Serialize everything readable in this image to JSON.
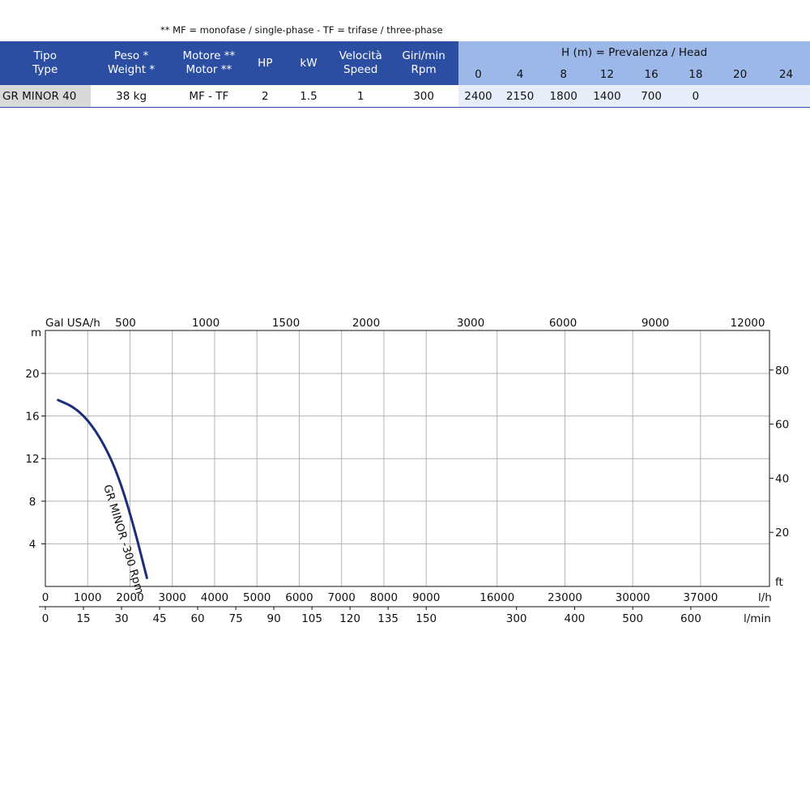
{
  "note": "** MF =  monofase / single-phase - TF =  trifase / three-phase",
  "table": {
    "headers": {
      "tipo": "Tipo",
      "type": "Type",
      "peso": "Peso  *",
      "weight": "Weight *",
      "motore": "Motore **",
      "motor": "Motor **",
      "hp": "HP",
      "kw": "kW",
      "velocita": "Velocità",
      "speed": "Speed",
      "giri": "Giri/min",
      "rpm": "Rpm",
      "head_title": "H (m)  =  Prevalenza  /  Head",
      "heads": [
        "0",
        "4",
        "8",
        "12",
        "16",
        "18",
        "20",
        "24"
      ]
    },
    "row": {
      "type": "GR  MINOR 40",
      "weight": "38 kg",
      "motor": "MF - TF",
      "hp": "2",
      "kw": "1.5",
      "speed": "1",
      "rpm": "300",
      "flows": [
        "2400",
        "2150",
        "1800",
        "1400",
        "700",
        "0",
        "",
        ""
      ]
    }
  },
  "chart_data": {
    "type": "line",
    "series": [
      {
        "name": "GR MINOR -300 Rpm",
        "x_lh": [
          300,
          700,
          1100,
          1500,
          1800,
          2100,
          2400
        ],
        "y_m": [
          17.5,
          16.8,
          15.2,
          12.5,
          9.5,
          5.5,
          0.8
        ]
      }
    ],
    "left_axis": {
      "label": "m",
      "ticks": [
        "4",
        "8",
        "12",
        "16",
        "20"
      ],
      "range": [
        0,
        24
      ]
    },
    "right_axis": {
      "label": "ft",
      "ticks": [
        "20",
        "40",
        "60",
        "80"
      ]
    },
    "top_axis": {
      "label": "Gal USA/h",
      "ticks": [
        "500",
        "1000",
        "1500",
        "2000",
        "3000",
        "6000",
        "9000",
        "12000"
      ]
    },
    "bottom_axis_lh": {
      "label": "l/h",
      "ticks": [
        "0",
        "1000",
        "2000",
        "3000",
        "4000",
        "5000",
        "6000",
        "7000",
        "8000",
        "9000",
        "16000",
        "23000",
        "30000",
        "37000"
      ]
    },
    "bottom_axis_lmin": {
      "label": "l/min",
      "ticks": [
        "0",
        "15",
        "30",
        "45",
        "60",
        "75",
        "90",
        "105",
        "120",
        "135",
        "150",
        "300",
        "400",
        "500",
        "600"
      ]
    },
    "grid": true,
    "line_color": "#1c2e7a"
  }
}
